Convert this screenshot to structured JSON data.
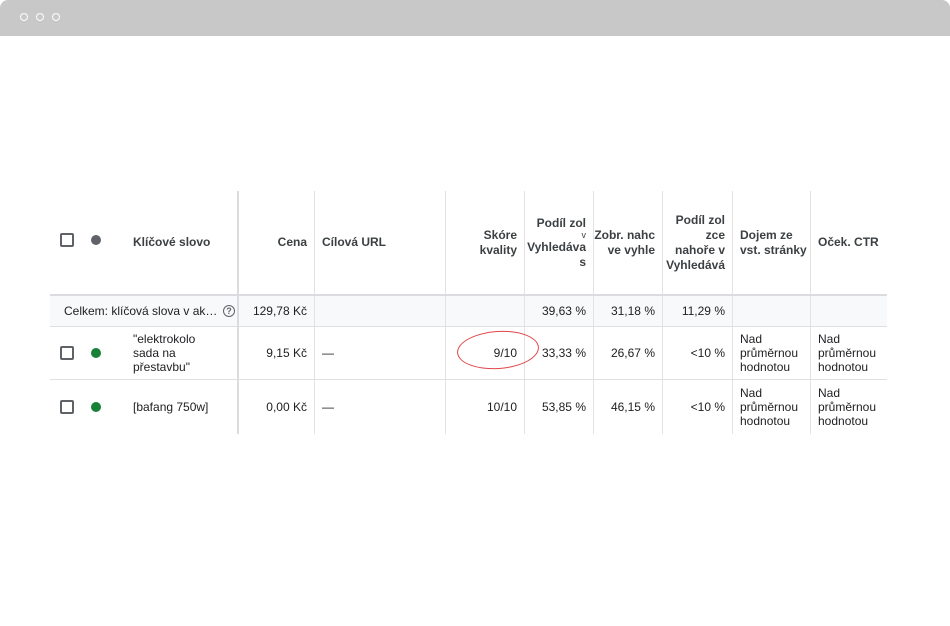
{
  "header": {
    "keyword": "Klíčové slovo",
    "cost": "Cena",
    "final_url": "Cílová URL",
    "quality_score": [
      "Skóre",
      "kvality"
    ],
    "impr_share": [
      "Podíl zol",
      "v",
      "Vyhledáva",
      "s"
    ],
    "top_impr": [
      "Zobr. nahc",
      "ve vyhle"
    ],
    "top_share": [
      "Podíl zol",
      "zce",
      "nahoře v",
      "Vyhledává"
    ],
    "landing_page_exp": [
      "Dojem ze",
      "vst. stránky"
    ],
    "exp_ctr": "Oček. CTR"
  },
  "total": {
    "label": "Celkem: klíčová slova v ak…",
    "help_icon": "?",
    "cost": "129,78 Kč",
    "impr_share": "39,63 %",
    "top_impr": "31,18 %",
    "top_share": "11,29 %"
  },
  "rows": [
    {
      "status": "green",
      "keyword": [
        "\"elektrokolo",
        "sada na",
        "přestavbu\""
      ],
      "cost": "9,15 Kč",
      "final_url": "—",
      "quality_score": "9/10",
      "impr_share": "33,33 %",
      "top_impr": "26,67 %",
      "top_share": "<10 %",
      "landing_page_exp": [
        "Nad",
        "průměrnou",
        "hodnotou"
      ],
      "exp_ctr": [
        "Nad",
        "průměrnou",
        "hodnotou"
      ]
    },
    {
      "status": "green",
      "keyword": [
        "[bafang 750w]"
      ],
      "cost": "0,00 Kč",
      "final_url": "—",
      "quality_score": "10/10",
      "impr_share": "53,85 %",
      "top_impr": "46,15 %",
      "top_share": "<10 %",
      "landing_page_exp": [
        "Nad",
        "průměrnou",
        "hodnotou"
      ],
      "exp_ctr": [
        "Nad",
        "průměrnou",
        "hodnotou"
      ]
    }
  ],
  "colors": {
    "status_green": "#188038",
    "annotation_red": "#e0474c"
  }
}
